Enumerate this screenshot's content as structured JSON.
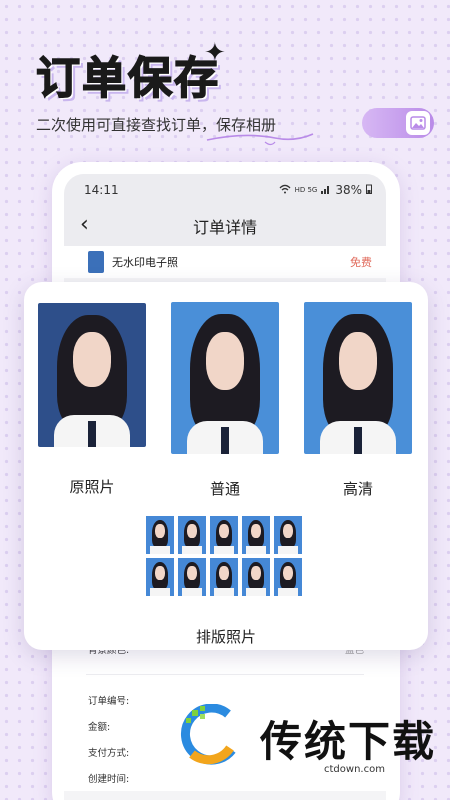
{
  "promo": {
    "headline": "订单保存",
    "subline": "二次使用可直接查找订单，保存相册"
  },
  "phone": {
    "status": {
      "time": "14:11",
      "network": "HD 5G",
      "battery": "38%"
    },
    "nav_title": "订单详情",
    "order_item": {
      "name": "无水印电子照",
      "price": "免费"
    },
    "bg_color": {
      "label": "背景颜色:",
      "value": "蓝色"
    },
    "details": [
      {
        "label": "订单编号:"
      },
      {
        "label": "金额:"
      },
      {
        "label": "支付方式:"
      },
      {
        "label": "创建时间:"
      }
    ]
  },
  "card": {
    "original_label": "原照片",
    "normal_label": "普通",
    "hd_label": "高清",
    "layout_label": "排版照片",
    "bg_colors": {
      "original": "#2e4f8a",
      "normal": "#4a8fd8",
      "hd": "#4a8fd8"
    },
    "layout_count": 10
  },
  "watermark": {
    "name": "传统下载",
    "url": "ctdown.com"
  },
  "colors": {
    "accent": "#b98be8",
    "price": "#e06a5b",
    "background": "#f1e9fa"
  }
}
